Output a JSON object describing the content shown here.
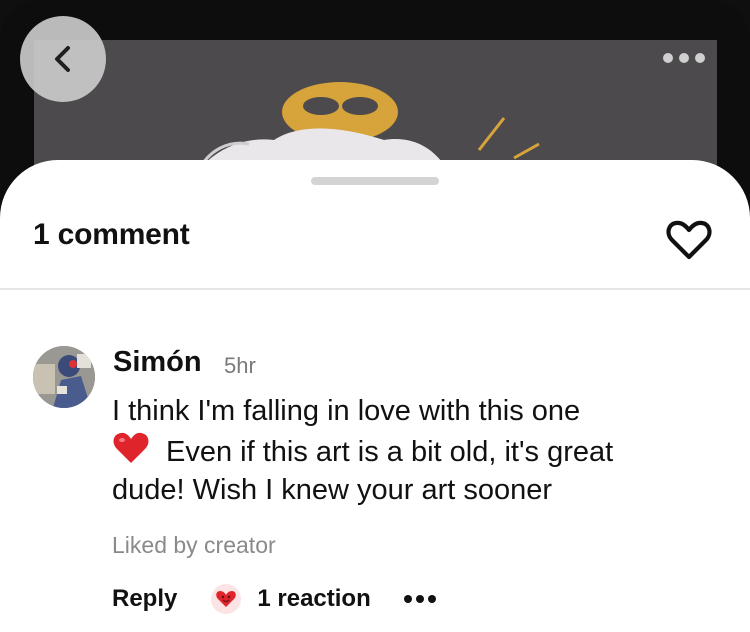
{
  "sheet": {
    "title": "1 comment"
  },
  "comment": {
    "author": "Simón",
    "time": "5hr",
    "text_lines": [
      "I think I'm falling in love with this one",
      "Even if this art is a bit old, it's great",
      "dude! Wish I knew your art sooner"
    ],
    "liked_by": "Liked by creator",
    "reply_label": "Reply",
    "reaction_label": "1 reaction"
  },
  "icons": {
    "back": "chevron-left-icon",
    "more": "more-horizontal-icon",
    "favorite": "heart-outline-icon",
    "emoji": "red-heart-emoji",
    "reaction": "heart-face-emoji"
  },
  "colors": {
    "sheet_background": "#ffffff",
    "heart_red": "#e0242b",
    "muted_text": "#8a8a8a"
  }
}
